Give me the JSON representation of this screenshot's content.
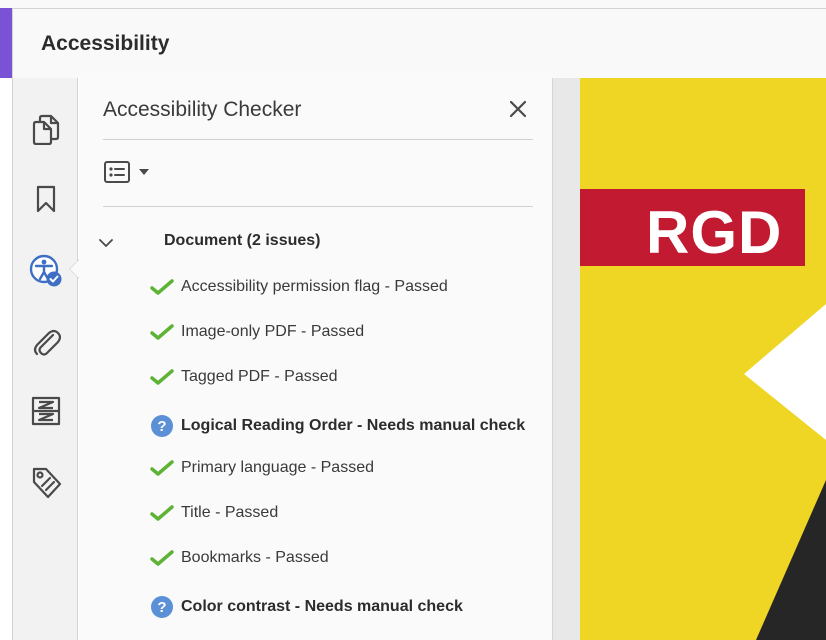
{
  "header": {
    "title": "Accessibility"
  },
  "panel": {
    "title": "Accessibility Checker",
    "close_icon": "close-icon",
    "options_icon": "options-list-icon"
  },
  "tree": {
    "document_label": "Document (2 issues)",
    "items": [
      {
        "label": "Accessibility permission flag - Passed",
        "status": "passed"
      },
      {
        "label": "Image-only PDF - Passed",
        "status": "passed"
      },
      {
        "label": "Tagged PDF - Passed",
        "status": "passed"
      },
      {
        "label": "Logical Reading Order - Needs manual check",
        "status": "manual"
      },
      {
        "label": "Primary language - Passed",
        "status": "passed"
      },
      {
        "label": "Title - Passed",
        "status": "passed"
      },
      {
        "label": "Bookmarks - Passed",
        "status": "passed"
      },
      {
        "label": "Color contrast - Needs manual check",
        "status": "manual"
      }
    ]
  },
  "rail": {
    "icons": [
      "pages-icon",
      "bookmark-icon",
      "accessibility-icon",
      "attachment-icon",
      "compare-icon",
      "tag-icon"
    ]
  },
  "document_preview": {
    "logo_text": "RGD"
  },
  "colors": {
    "accent": "#7a52d6",
    "passed": "#5cb335",
    "manual": "#5b8fd6",
    "doc_bg": "#efd624",
    "logo_band": "#c21b31"
  }
}
